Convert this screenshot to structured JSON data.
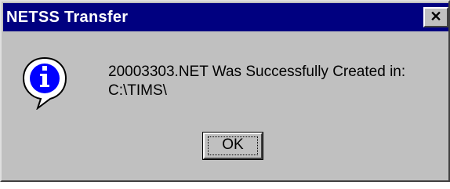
{
  "window": {
    "title": "NETSS Transfer",
    "close_glyph": "✕"
  },
  "dialog": {
    "icon": "information-icon",
    "message_line1": "20003303.NET Was Successfully Created in:",
    "message_line2": "C:\\TIMS\\",
    "ok_label": "OK"
  },
  "colors": {
    "titlebar": "#000080",
    "face": "#c0c0c0",
    "icon_blue": "#0000ff"
  }
}
